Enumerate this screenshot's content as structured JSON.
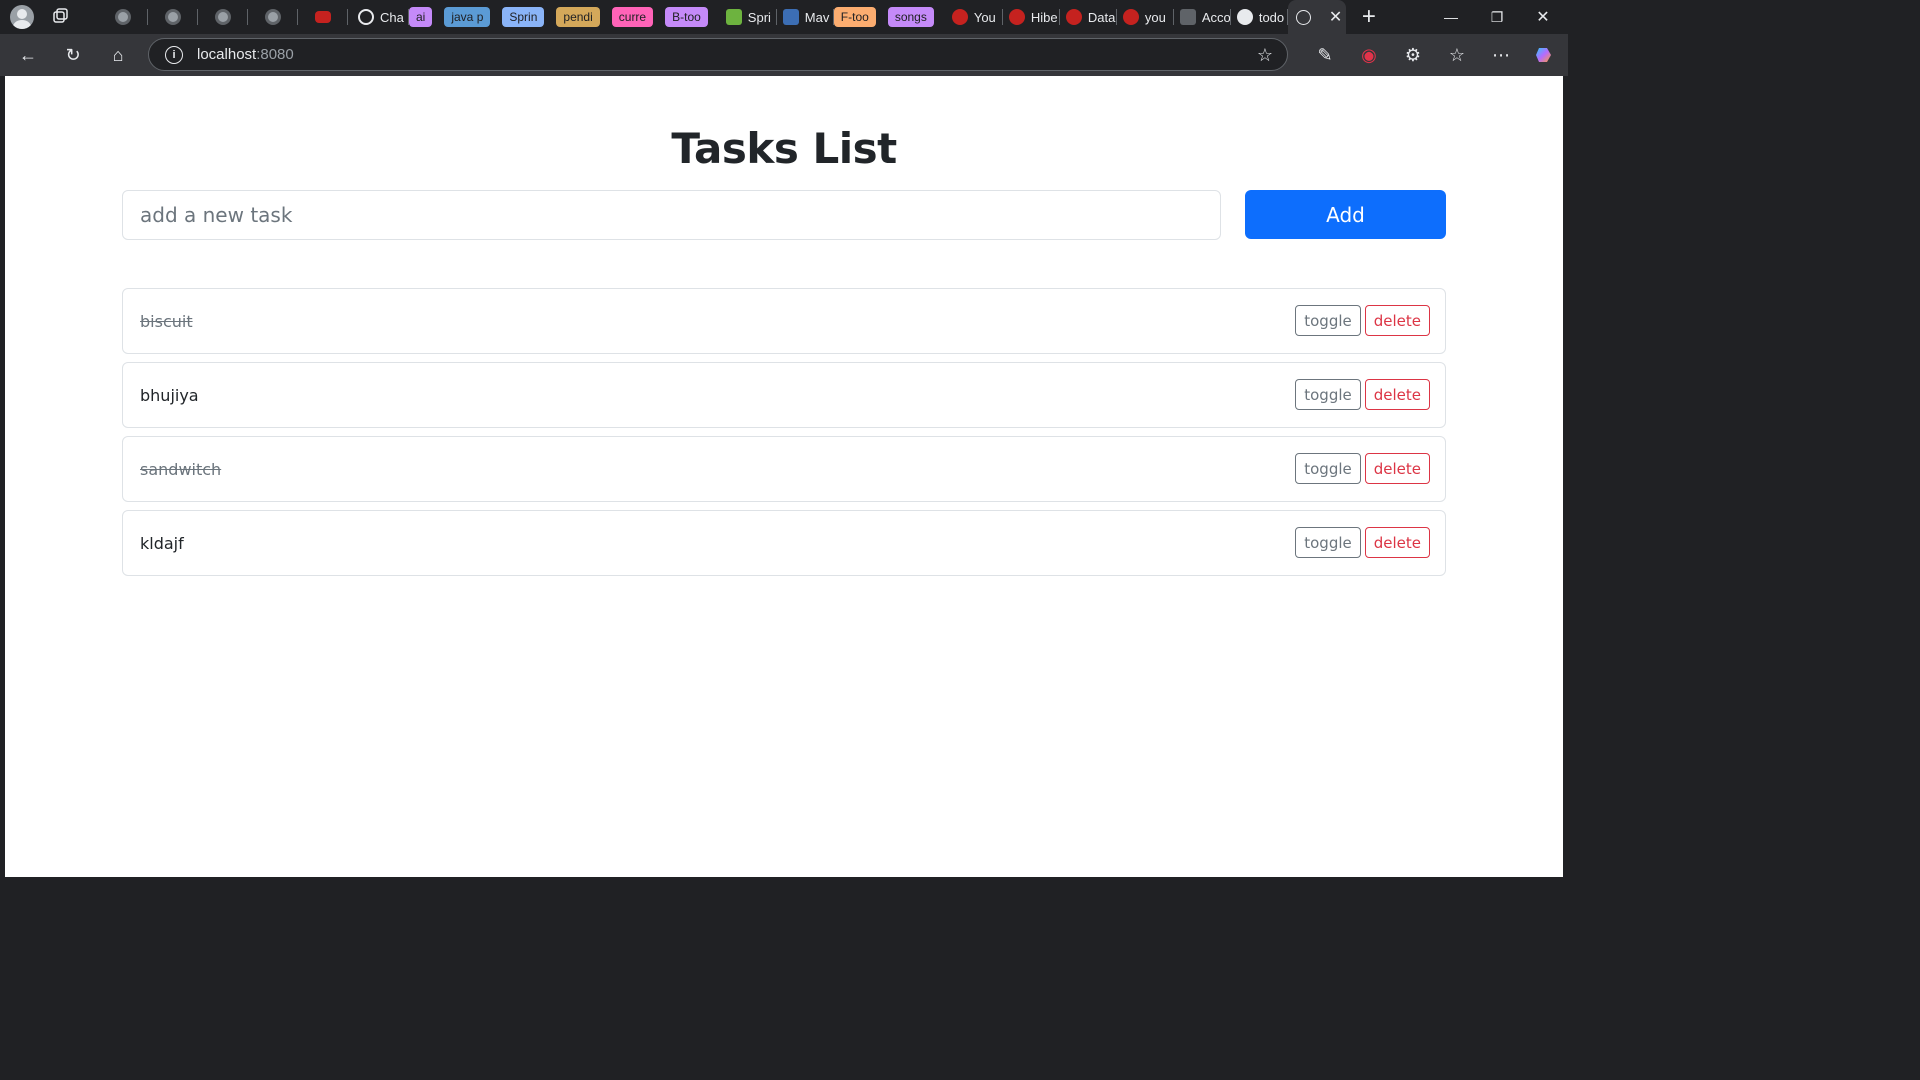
{
  "browser": {
    "pinned_tabs": [
      "openai-icon",
      "openai-icon",
      "openai-icon",
      "openai-icon",
      "youtube-icon"
    ],
    "tabs": [
      {
        "kind": "tab",
        "label": "Cha",
        "icon": "openai-icon",
        "fav_color": "#e8eaed"
      },
      {
        "kind": "group",
        "label": "ai",
        "color": "#c58af9"
      },
      {
        "kind": "group",
        "label": "java p",
        "color": "#5b9bd5"
      },
      {
        "kind": "group",
        "label": "Sprin",
        "color": "#8ab4f8"
      },
      {
        "kind": "group",
        "label": "pendi",
        "color": "#d4a85a"
      },
      {
        "kind": "group",
        "label": "curre",
        "color": "#ff63b8"
      },
      {
        "kind": "group",
        "label": "B-too",
        "color": "#c58af9"
      },
      {
        "kind": "tab",
        "label": "Spri",
        "icon": "spring-icon",
        "fav_color": "#6db33f"
      },
      {
        "kind": "tab",
        "label": "Mav",
        "icon": "maven-icon",
        "fav_color": "#3c6eb4"
      },
      {
        "kind": "group",
        "label": "F-too",
        "color": "#fcad70"
      },
      {
        "kind": "group",
        "label": "songs",
        "color": "#c58af9"
      },
      {
        "kind": "tab",
        "label": "You",
        "icon": "youtube-icon",
        "fav_color": "#ff0000"
      },
      {
        "kind": "tab",
        "label": "Hibe",
        "icon": "youtube-icon",
        "fav_color": "#ff0000"
      },
      {
        "kind": "tab",
        "label": "Data",
        "icon": "youtube-icon",
        "fav_color": "#ff0000"
      },
      {
        "kind": "tab",
        "label": "you",
        "icon": "youtube-icon",
        "fav_color": "#ff0000"
      },
      {
        "kind": "tab",
        "label": "Acco",
        "icon": "mt-icon",
        "fav_color": "#5f6368"
      },
      {
        "kind": "tab",
        "label": "todo",
        "icon": "github-icon",
        "fav_color": "#e8eaed"
      }
    ],
    "active_tab_icon": "globe-icon",
    "url_host": "localhost",
    "url_port": ":8080"
  },
  "app": {
    "title": "Tasks List",
    "input_placeholder": "add a new task",
    "add_label": "Add",
    "toggle_label": "toggle",
    "delete_label": "delete",
    "tasks": [
      {
        "name": "biscuit",
        "completed": true
      },
      {
        "name": "bhujiya",
        "completed": false
      },
      {
        "name": "sandwitch",
        "completed": true
      },
      {
        "name": "kldajf",
        "completed": false
      }
    ]
  }
}
